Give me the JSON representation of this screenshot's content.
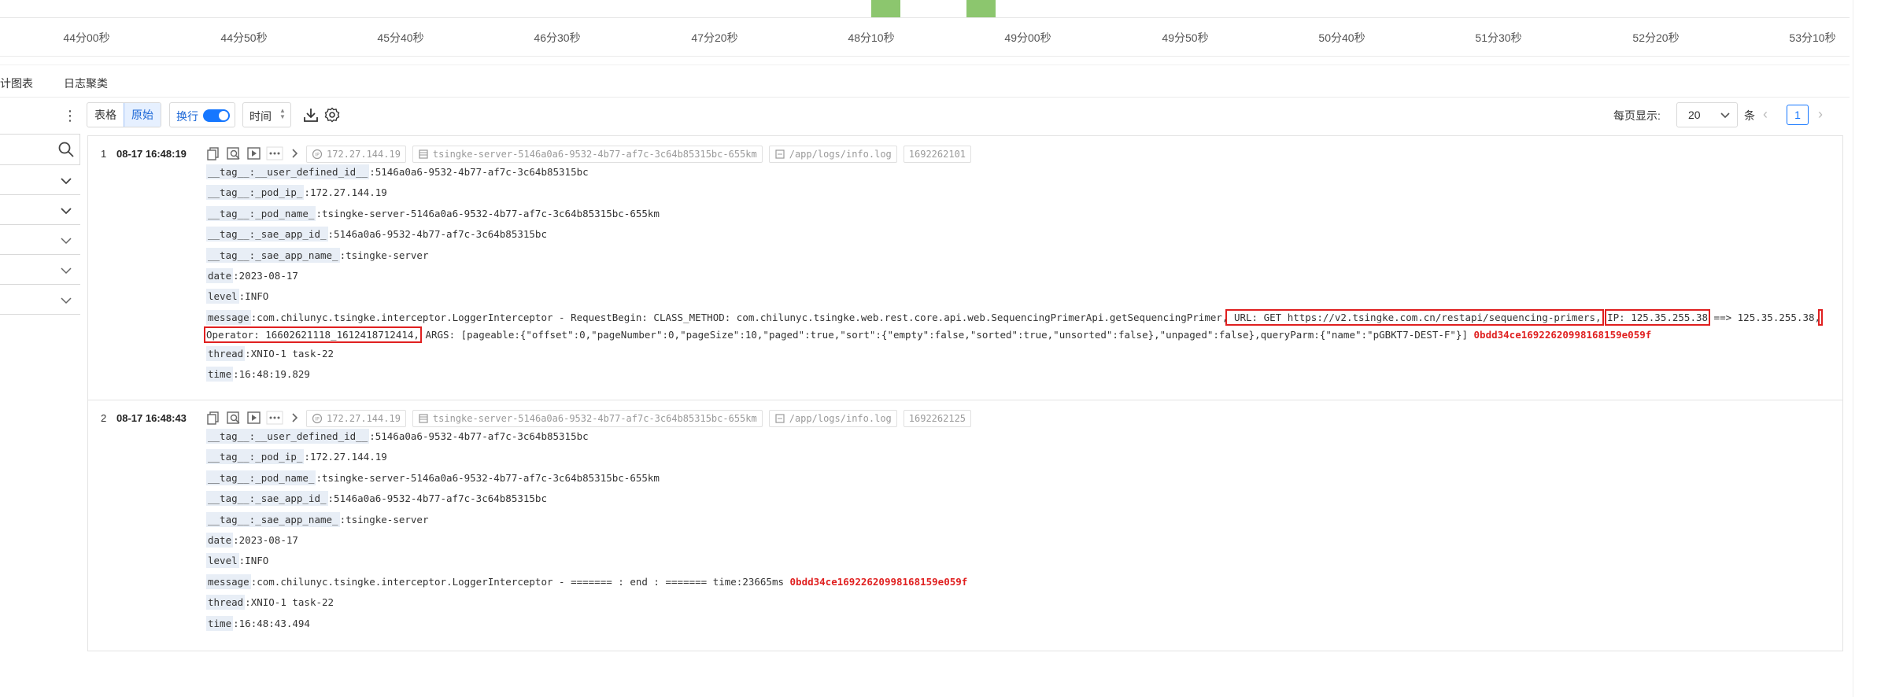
{
  "timeline": {
    "ticks": [
      "44分00秒",
      "44分50秒",
      "45分40秒",
      "46分30秒",
      "47分20秒",
      "48分10秒",
      "49分00秒",
      "49分50秒",
      "50分40秒",
      "51分30秒",
      "52分20秒",
      "53分10秒"
    ],
    "bar_color": "#8cc66e"
  },
  "tabs": {
    "items": [
      "计图表",
      "日志聚类"
    ]
  },
  "sidebar": {
    "more_icon": "more-vertical-icon",
    "search_icon": "search-icon"
  },
  "toolbar": {
    "view_table": "表格",
    "view_raw": "原始",
    "wrap_label": "换行",
    "wrap_on": true,
    "time_label": "时间",
    "download_icon": "download-icon",
    "settings_icon": "gear-icon",
    "per_page_label": "每页显示:",
    "per_page_value": "20",
    "per_page_unit": "条",
    "current_page": "1"
  },
  "logs": [
    {
      "num": "1",
      "timestamp": "08-17 16:48:19",
      "ip": "172.27.144.19",
      "pod": "tsingke-server-5146a0a6-9532-4b77-af7c-3c64b85315bc-655km",
      "path": "/app/logs/info.log",
      "epoch": "1692262101",
      "fields": [
        {
          "k": "__tag__:__user_defined_id__",
          "v": "5146a0a6-9532-4b77-af7c-3c64b85315bc"
        },
        {
          "k": "__tag__:_pod_ip_",
          "v": "172.27.144.19"
        },
        {
          "k": "__tag__:_pod_name_",
          "v": "tsingke-server-5146a0a6-9532-4b77-af7c-3c64b85315bc-655km"
        },
        {
          "k": "__tag__:_sae_app_id_",
          "v": "5146a0a6-9532-4b77-af7c-3c64b85315bc"
        },
        {
          "k": "__tag__:_sae_app_name_",
          "v": "tsingke-server"
        },
        {
          "k": "date",
          "v": "2023-08-17"
        },
        {
          "k": "level",
          "v": "INFO"
        }
      ],
      "message_key": "message",
      "message_pre": "com.chilunyc.tsingke.interceptor.LoggerInterceptor - RequestBegin: CLASS_METHOD: com.chilunyc.tsingke.web.rest.core.api.web.SequencingPrimerApi.getSequencingPrimer,",
      "message_url": " URL: GET https://v2.tsingke.com.cn/restapi/sequencing-primers,",
      "message_ip": " IP: 125.35.255.38",
      "message_mid": " ==> 125.35.255.38,",
      "message_operator": " Operator: 16602621118_1612418712414,",
      "message_post": " ARGS: [pageable:{\"offset\":0,\"pageNumber\":0,\"pageSize\":10,\"paged\":true,\"sort\":{\"empty\":false,\"sorted\":true,\"unsorted\":false},\"unpaged\":false},queryParm:{\"name\":\"pGBKT7-DEST-F\"}] ",
      "message_trace": "0bdd34ce16922620998168159e059f",
      "tail_fields": [
        {
          "k": "thread",
          "v": "XNIO-1 task-22"
        },
        {
          "k": "time",
          "v": "16:48:19.829"
        }
      ]
    },
    {
      "num": "2",
      "timestamp": "08-17 16:48:43",
      "ip": "172.27.144.19",
      "pod": "tsingke-server-5146a0a6-9532-4b77-af7c-3c64b85315bc-655km",
      "path": "/app/logs/info.log",
      "epoch": "1692262125",
      "fields": [
        {
          "k": "__tag__:__user_defined_id__",
          "v": "5146a0a6-9532-4b77-af7c-3c64b85315bc"
        },
        {
          "k": "__tag__:_pod_ip_",
          "v": "172.27.144.19"
        },
        {
          "k": "__tag__:_pod_name_",
          "v": "tsingke-server-5146a0a6-9532-4b77-af7c-3c64b85315bc-655km"
        },
        {
          "k": "__tag__:_sae_app_id_",
          "v": "5146a0a6-9532-4b77-af7c-3c64b85315bc"
        },
        {
          "k": "__tag__:_sae_app_name_",
          "v": "tsingke-server"
        },
        {
          "k": "date",
          "v": "2023-08-17"
        },
        {
          "k": "level",
          "v": "INFO"
        }
      ],
      "message_key": "message",
      "message_pre": "com.chilunyc.tsingke.interceptor.LoggerInterceptor - ======= : end : ======= time:23665ms ",
      "message_trace": "0bdd34ce16922620998168159e059f",
      "tail_fields": [
        {
          "k": "thread",
          "v": "XNIO-1 task-22"
        },
        {
          "k": "time",
          "v": "16:48:43.494"
        }
      ]
    }
  ]
}
